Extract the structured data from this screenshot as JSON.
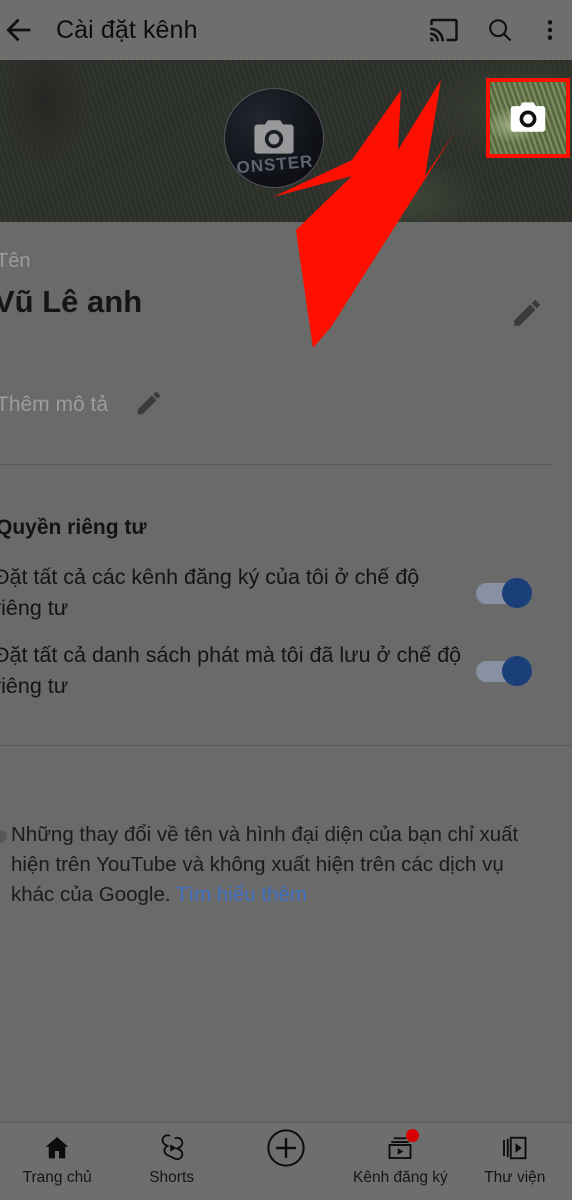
{
  "app": {
    "accent_red": "#fd1000",
    "link_blue": "#3f6ec0",
    "toggle_on_color": "#1b3f79",
    "background": "#6a6a6a"
  },
  "topbar": {
    "back_icon": "arrow-left-icon",
    "title": "Cài đặt kênh",
    "cast_icon": "cast-icon",
    "search_icon": "search-icon",
    "overflow_icon": "more-vert-icon"
  },
  "banner": {
    "avatar_word": "ONSTER",
    "avatar_camera_icon": "camera-icon",
    "banner_camera_icon": "camera-icon",
    "highlight_color": "#fd1000"
  },
  "profile": {
    "name_label": "Tên",
    "name_value": "Vũ Lê anh",
    "name_edit_icon": "pencil-icon",
    "description_placeholder": "Thêm mô tả",
    "description_edit_icon": "pencil-icon"
  },
  "privacy": {
    "section_title": "Quyền riêng tư",
    "items": [
      {
        "label": "Đặt tất cả các kênh đăng ký của tôi ở chế độ riêng tư",
        "state": "on"
      },
      {
        "label": "Đặt tất cả danh sách phát mà tôi đã lưu ở chế độ riêng tư",
        "state": "on"
      }
    ]
  },
  "note": {
    "text": "Những thay đổi về tên và hình đại diện của bạn chỉ xuất hiện trên YouTube và không xuất hiện trên các dịch vụ khác của Google. ",
    "link_text": "Tìm hiểu thêm"
  },
  "bottomnav": {
    "items": [
      {
        "label": "Trang chủ",
        "icon": "home-icon",
        "badge": false
      },
      {
        "label": "Shorts",
        "icon": "shorts-icon",
        "badge": false
      },
      {
        "label": "",
        "icon": "plus-circle-icon",
        "badge": false
      },
      {
        "label": "Kênh đăng ký",
        "icon": "subscriptions-icon",
        "badge": true
      },
      {
        "label": "Thư viện",
        "icon": "library-icon",
        "badge": false
      }
    ]
  },
  "annotation": {
    "arrow_color": "#fd1000",
    "arrow_points_to": "banner-camera-button"
  }
}
